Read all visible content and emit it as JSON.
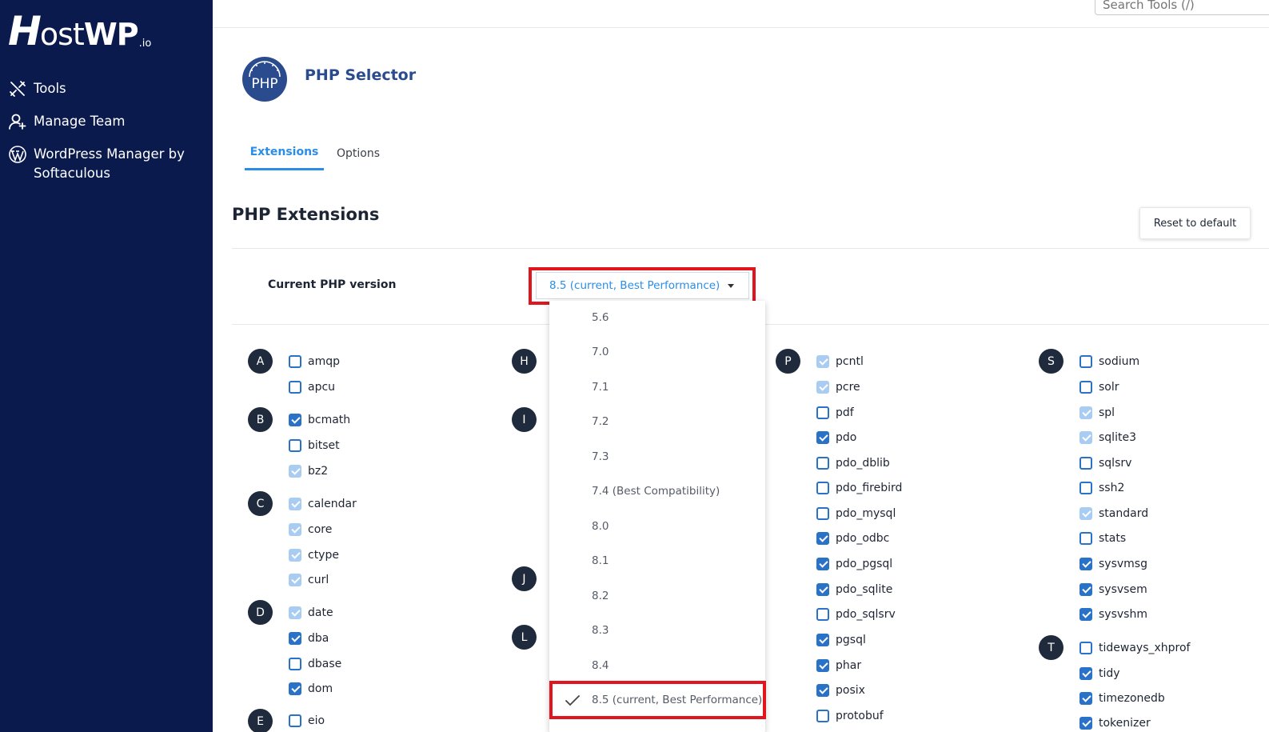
{
  "brand": {
    "h": "H",
    "ost": "ost",
    "wp": "WP",
    "io": ".io"
  },
  "sidebar": {
    "items": [
      {
        "label": "Tools",
        "icon": "tools-icon"
      },
      {
        "label": "Manage Team",
        "icon": "team-icon"
      },
      {
        "label": "WordPress Manager by Softaculous",
        "icon": "wordpress-icon"
      }
    ]
  },
  "topbar": {
    "search_placeholder": "Search Tools (/)"
  },
  "header": {
    "logo_text": "PHP",
    "title": "PHP Selector"
  },
  "tabs": [
    {
      "label": "Extensions",
      "active": true
    },
    {
      "label": "Options",
      "active": false
    }
  ],
  "section": {
    "title": "PHP Extensions",
    "reset_label": "Reset to default"
  },
  "version": {
    "label": "Current PHP version",
    "selected": "8.5 (current, Best Performance)",
    "options": [
      "5.6",
      "7.0",
      "7.1",
      "7.2",
      "7.3",
      "7.4 (Best Compatibility)",
      "8.0",
      "8.1",
      "8.2",
      "8.3",
      "8.4",
      "8.5 (current, Best Performance)"
    ]
  },
  "colors": {
    "sidebar": "#0b1a4d",
    "accent": "#2a8ee8",
    "highlight": "#e0151d",
    "checkbox": "#2a72c7"
  },
  "letters": [
    "A",
    "B",
    "C",
    "D",
    "E",
    "H",
    "I",
    "J",
    "L",
    "P",
    "S",
    "T"
  ],
  "extensions": {
    "col1": [
      {
        "name": "amqp",
        "state": "off"
      },
      {
        "name": "apcu",
        "state": "off"
      },
      {
        "name": "bcmath",
        "state": "on"
      },
      {
        "name": "bitset",
        "state": "off"
      },
      {
        "name": "bz2",
        "state": "disabled"
      },
      {
        "name": "calendar",
        "state": "disabled"
      },
      {
        "name": "core",
        "state": "disabled"
      },
      {
        "name": "ctype",
        "state": "disabled"
      },
      {
        "name": "curl",
        "state": "disabled"
      },
      {
        "name": "date",
        "state": "disabled"
      },
      {
        "name": "dba",
        "state": "on"
      },
      {
        "name": "dbase",
        "state": "off"
      },
      {
        "name": "dom",
        "state": "on"
      },
      {
        "name": "eio",
        "state": "off"
      }
    ],
    "col3": [
      {
        "name": "pcntl",
        "state": "disabled"
      },
      {
        "name": "pcre",
        "state": "disabled"
      },
      {
        "name": "pdf",
        "state": "off"
      },
      {
        "name": "pdo",
        "state": "on"
      },
      {
        "name": "pdo_dblib",
        "state": "off"
      },
      {
        "name": "pdo_firebird",
        "state": "off"
      },
      {
        "name": "pdo_mysql",
        "state": "off"
      },
      {
        "name": "pdo_odbc",
        "state": "on"
      },
      {
        "name": "pdo_pgsql",
        "state": "on"
      },
      {
        "name": "pdo_sqlite",
        "state": "on"
      },
      {
        "name": "pdo_sqlsrv",
        "state": "off"
      },
      {
        "name": "pgsql",
        "state": "on"
      },
      {
        "name": "phar",
        "state": "on"
      },
      {
        "name": "posix",
        "state": "on"
      },
      {
        "name": "protobuf",
        "state": "off"
      }
    ],
    "col4": [
      {
        "name": "sodium",
        "state": "off"
      },
      {
        "name": "solr",
        "state": "off"
      },
      {
        "name": "spl",
        "state": "disabled"
      },
      {
        "name": "sqlite3",
        "state": "disabled"
      },
      {
        "name": "sqlsrv",
        "state": "off"
      },
      {
        "name": "ssh2",
        "state": "off"
      },
      {
        "name": "standard",
        "state": "disabled"
      },
      {
        "name": "stats",
        "state": "off"
      },
      {
        "name": "sysvmsg",
        "state": "on"
      },
      {
        "name": "sysvsem",
        "state": "on"
      },
      {
        "name": "sysvshm",
        "state": "on"
      },
      {
        "name": "tideways_xhprof",
        "state": "off"
      },
      {
        "name": "tidy",
        "state": "on"
      },
      {
        "name": "timezonedb",
        "state": "on"
      },
      {
        "name": "tokenizer",
        "state": "on"
      }
    ]
  }
}
